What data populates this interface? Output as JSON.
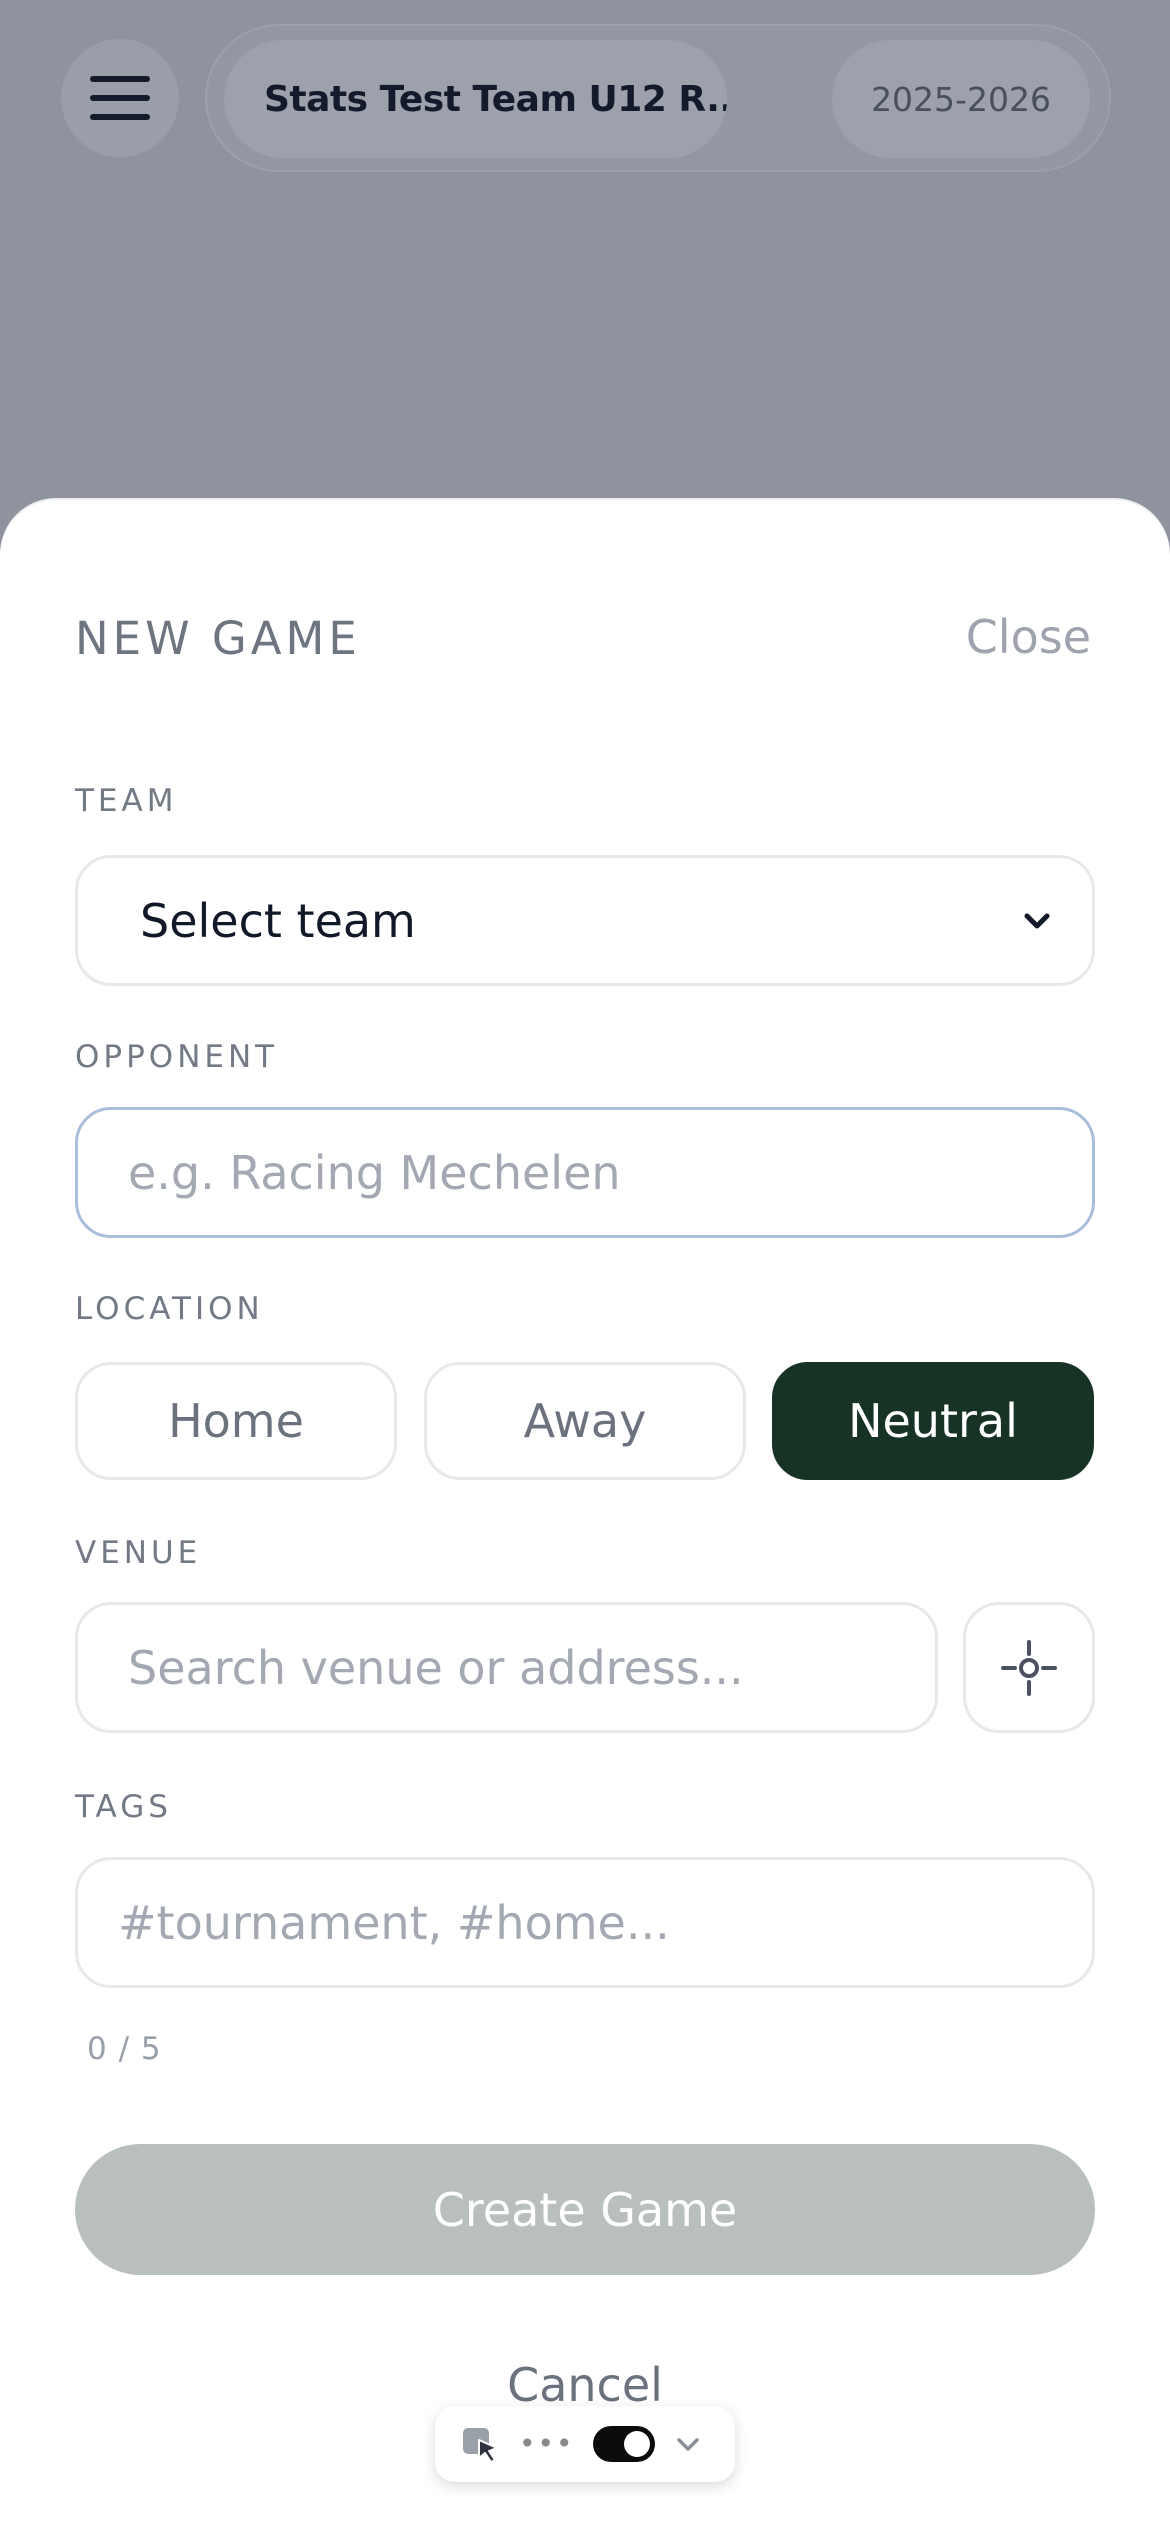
{
  "header": {
    "team_name": "Stats Test Team U12 R...",
    "season": "2025-2026",
    "menu_icon": "hamburger-icon"
  },
  "sheet": {
    "title": "NEW GAME",
    "close_label": "Close",
    "team": {
      "label": "TEAM",
      "selected_value": "Select team",
      "icon": "chevron-down-icon"
    },
    "opponent": {
      "label": "OPPONENT",
      "placeholder": "e.g. Racing Mechelen",
      "value": ""
    },
    "location": {
      "label": "LOCATION",
      "options": [
        "Home",
        "Away",
        "Neutral"
      ],
      "selected": "Neutral"
    },
    "venue": {
      "label": "VENUE",
      "placeholder": "Search venue or address...",
      "value": "",
      "locate_icon": "crosshair-icon"
    },
    "tags": {
      "label": "TAGS",
      "placeholder": "#tournament, #home...",
      "count": "0 / 5"
    },
    "create_label": "Create Game",
    "cancel_label": "Cancel"
  },
  "toolbar": {
    "cursor_icon": "cursor-select-icon",
    "more_icon": "more-dots-icon",
    "toggle_icon": "toggle-switch-icon",
    "chevron_icon": "chevron-down-icon"
  },
  "colors": {
    "accent_dark_green": "#173326",
    "disabled_button": "#b8bfbc",
    "overlay": "#8f939e",
    "focus_border": "#a8bedb"
  }
}
